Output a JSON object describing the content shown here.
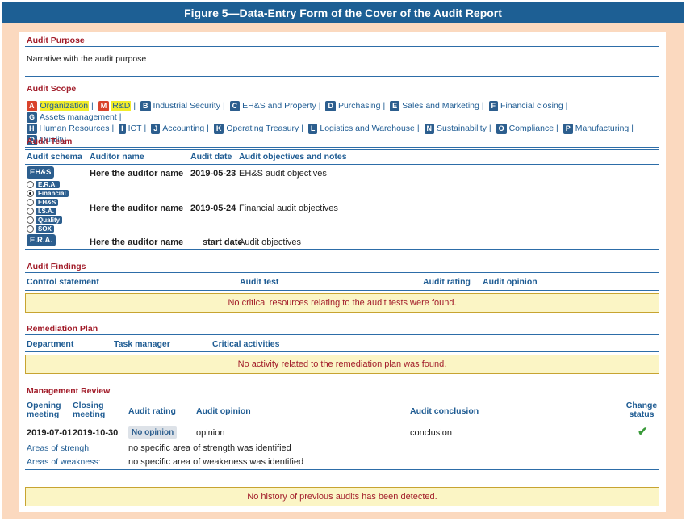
{
  "title": "Figure 5—Data-Entry Form of the Cover of the Audit Report",
  "purpose": {
    "heading": "Audit Purpose",
    "text": "Narrative with the audit purpose"
  },
  "scope": {
    "heading": "Audit Scope",
    "items": [
      {
        "code": "A",
        "label": "Organization",
        "selected": true
      },
      {
        "code": "M",
        "label": "R&D",
        "selected": true
      },
      {
        "code": "B",
        "label": "Industrial Security"
      },
      {
        "code": "C",
        "label": "EH&S and Property"
      },
      {
        "code": "D",
        "label": "Purchasing"
      },
      {
        "code": "E",
        "label": "Sales and Marketing"
      },
      {
        "code": "F",
        "label": "Financial closing"
      },
      {
        "code": "G",
        "label": "Assets management"
      },
      {
        "code": "H",
        "label": "Human Resources"
      },
      {
        "code": "I",
        "label": "ICT"
      },
      {
        "code": "J",
        "label": "Accounting"
      },
      {
        "code": "K",
        "label": "Operating Treasury"
      },
      {
        "code": "L",
        "label": "Logistics and Warehouse"
      },
      {
        "code": "N",
        "label": "Sustainability"
      },
      {
        "code": "O",
        "label": "Compliance"
      },
      {
        "code": "P",
        "label": "Manufacturing"
      },
      {
        "code": "Q",
        "label": "Quality"
      }
    ]
  },
  "team": {
    "heading": "Audit Team",
    "columns": [
      "Audit schema",
      "Auditor name",
      "Audit date",
      "Audit objectives and notes"
    ],
    "rows": [
      {
        "schema": "EH&S",
        "auditor": "Here the auditor name",
        "date": "2019-05-23",
        "objectives": "EH&S audit objectives"
      },
      {
        "schema": "",
        "auditor": "Here the auditor name",
        "date": "2019-05-24",
        "objectives": "Financial audit objectives"
      },
      {
        "schema": "E.R.A.",
        "auditor": "Here the auditor name",
        "date": "start date",
        "objectives": "Audit objectives"
      }
    ],
    "schema_options": [
      {
        "label": "E.R.A.",
        "checked": false
      },
      {
        "label": "Financial",
        "checked": true
      },
      {
        "label": "EH&S",
        "checked": false
      },
      {
        "label": "I.S.A.",
        "checked": false
      },
      {
        "label": "Quality",
        "checked": false
      },
      {
        "label": "SOX",
        "checked": false
      }
    ]
  },
  "findings": {
    "heading": "Audit Findings",
    "columns": [
      "Control statement",
      "Audit test",
      "Audit rating",
      "Audit opinion"
    ],
    "notice": "No critical resources relating to the audit tests were found."
  },
  "remediation": {
    "heading": "Remediation Plan",
    "columns": [
      "Department",
      "Task manager",
      "Critical activities"
    ],
    "notice": "No activity related to the remediation plan was found."
  },
  "review": {
    "heading": "Management Review",
    "columns": {
      "opening": [
        "Opening",
        "meeting"
      ],
      "closing": [
        "Closing",
        "meeting"
      ],
      "rating": "Audit rating",
      "opinion": "Audit opinion",
      "conclusion": "Audit conclusion",
      "change": [
        "Change",
        "status"
      ]
    },
    "row": {
      "opening": "2019-07-01",
      "closing": "2019-10-30",
      "rating": "No opinion",
      "opinion": "opinion",
      "conclusion": "conclusion"
    },
    "strength_label": "Areas of strengh:",
    "strength_text": "no specific area of strength was identified",
    "weakness_label": "Areas of weakness:",
    "weakness_text": "no specific area of weakeness was identified"
  },
  "history_notice": "No history of previous audits has been detected.",
  "colors": {
    "header": "#1d5f94",
    "section_title": "#a21d2a",
    "background": "#fbd9bf",
    "notice": "#fbf5c5"
  }
}
